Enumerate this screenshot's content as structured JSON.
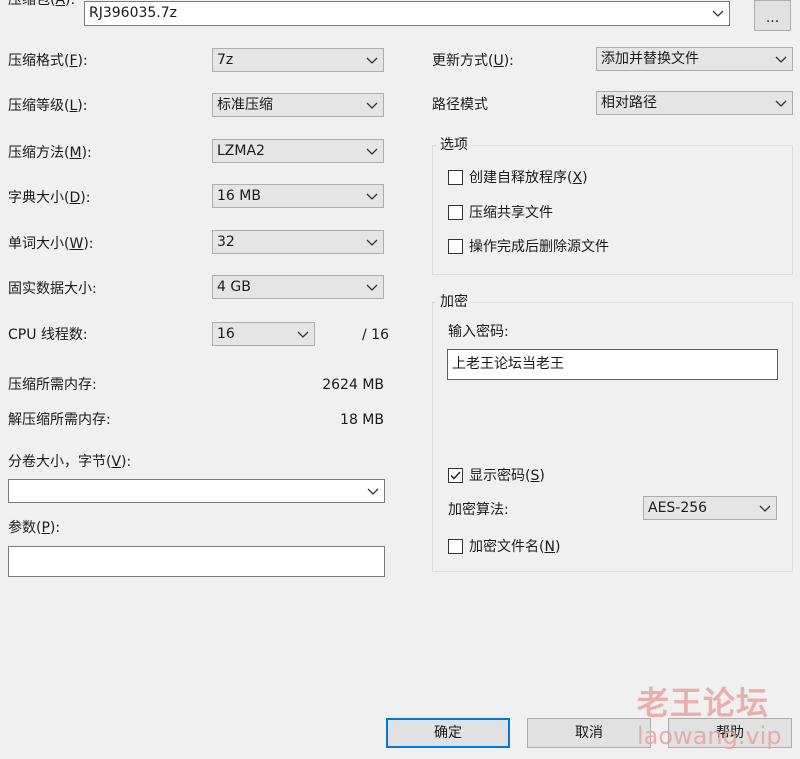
{
  "archive": {
    "label_prefix": "压缩包(",
    "label_key": "A",
    "label_suffix": "):",
    "value": "RJ396035.7z",
    "browse_label": "..."
  },
  "left": {
    "format": {
      "prefix": "压缩格式(",
      "key": "F",
      "suffix": "):",
      "value": "7z"
    },
    "level": {
      "prefix": "压缩等级(",
      "key": "L",
      "suffix": "):",
      "value": "标准压缩"
    },
    "method": {
      "prefix": "压缩方法(",
      "key": "M",
      "suffix": "):",
      "value": "LZMA2"
    },
    "dict": {
      "prefix": "字典大小(",
      "key": "D",
      "suffix": "):",
      "value": "16 MB"
    },
    "word": {
      "prefix": "单词大小(",
      "key": "W",
      "suffix": "):",
      "value": "32"
    },
    "solid": {
      "label": "固实数据大小:",
      "value": "4 GB"
    },
    "threads": {
      "label": "CPU 线程数:",
      "value": "16",
      "max": "/ 16"
    },
    "mem_compress": {
      "label": "压缩所需内存:",
      "value": "2624 MB"
    },
    "mem_decompress": {
      "label": "解压缩所需内存:",
      "value": "18 MB"
    },
    "volume": {
      "prefix": "分卷大小，字节(",
      "key": "V",
      "suffix": "):",
      "value": ""
    },
    "params": {
      "prefix": "参数(",
      "key": "P",
      "suffix": "):",
      "value": ""
    }
  },
  "right": {
    "update": {
      "prefix": "更新方式(",
      "key": "U",
      "suffix": "):",
      "value": "添加并替换文件"
    },
    "path": {
      "label": "路径模式",
      "value": "相对路径"
    },
    "options": {
      "title": "选项",
      "sfx": {
        "prefix": "创建自释放程序(",
        "key": "X",
        "suffix": ")",
        "checked": false
      },
      "shared": {
        "label": "压缩共享文件",
        "checked": false
      },
      "delete": {
        "label": "操作完成后删除源文件",
        "checked": false
      }
    },
    "encryption": {
      "title": "加密",
      "password_label": "输入密码:",
      "password": "上老王论坛当老王",
      "show": {
        "prefix": "显示密码(",
        "key": "S",
        "suffix": ")",
        "checked": true
      },
      "algo": {
        "label": "加密算法:",
        "value": "AES-256"
      },
      "names": {
        "prefix": "加密文件名(",
        "key": "N",
        "suffix": ")",
        "checked": false
      }
    }
  },
  "buttons": {
    "ok": "确定",
    "cancel": "取消",
    "help": "帮助"
  },
  "watermark": {
    "cn": "老王论坛",
    "en": "laowang.vip"
  },
  "colors": {
    "default_button_border": "#0078d7",
    "watermark": "#e8a3a3"
  }
}
